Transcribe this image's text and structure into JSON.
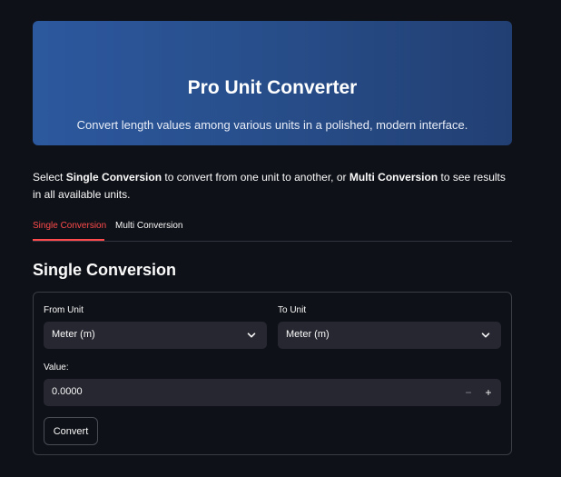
{
  "hero": {
    "title": "Pro Unit Converter",
    "subtitle": "Convert length values among various units in a polished, modern interface.",
    "background_color": "#2a5499"
  },
  "intro": {
    "part1": "Select ",
    "bold1": "Single Conversion",
    "part2": " to convert from one unit to another, or ",
    "bold2": "Multi Conversion",
    "part3": " to see results in all available units."
  },
  "tabs": [
    {
      "label": "Single Conversion",
      "active": true
    },
    {
      "label": "Multi Conversion",
      "active": false
    }
  ],
  "accent_color": "#ff4b4b",
  "section_title": "Single Conversion",
  "form": {
    "from_label": "From Unit",
    "from_value": "Meter (m)",
    "to_label": "To Unit",
    "to_value": "Meter (m)",
    "value_label": "Value:",
    "value": "0.0000",
    "minus_label": "−",
    "plus_label": "+",
    "convert_label": "Convert"
  },
  "icons": {
    "select_arrow": "chevron-down-icon"
  }
}
